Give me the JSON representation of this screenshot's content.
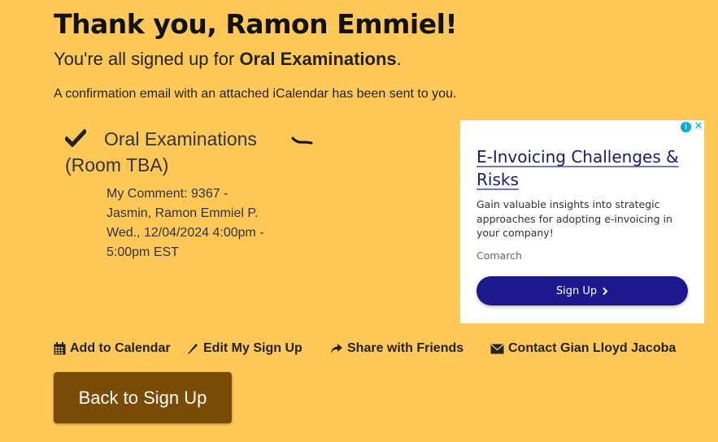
{
  "header": {
    "title": "Thank you, Ramon Emmiel!",
    "subtitle_prefix": "You're all signed up for ",
    "subtitle_event": "Oral Examinations",
    "subtitle_suffix": ".",
    "confirmation": "A confirmation email with an attached iCalendar has been sent to you."
  },
  "slot": {
    "icon": "check-icon",
    "title": "Oral Examinations",
    "location": "(Room TBA)",
    "comment": "My Comment: 9367 - Jasmin, Ramon Emmiel P.",
    "datetime": "Wed., 12/04/2024 4:00pm - 5:00pm EST"
  },
  "ad": {
    "headline": "E-Invoicing Challenges & Risks",
    "description": "Gain valuable insights into strategic approaches for adopting e-invoicing in your company!",
    "brand": "Comarch",
    "cta": "Sign Up",
    "info_glyph": "i",
    "close_glyph": "✕",
    "accent": "#1d1890"
  },
  "actions": [
    {
      "label": "Add to Calendar",
      "icon": "calendar-icon"
    },
    {
      "label": "Edit My Sign Up",
      "icon": "pencil-icon"
    },
    {
      "label": "Share with Friends",
      "icon": "share-icon"
    },
    {
      "label": "Contact Gian Lloyd Jacoba",
      "icon": "envelope-icon"
    }
  ],
  "back_button": {
    "label": "Back to Sign Up"
  },
  "colors": {
    "background": "#ffc857",
    "button": "#7a4b04",
    "ad_button": "#1d1890"
  }
}
